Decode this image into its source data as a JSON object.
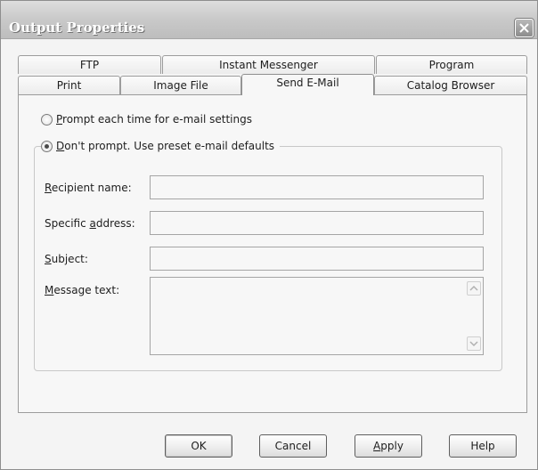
{
  "window": {
    "title": "Output Properties"
  },
  "tabs": {
    "row_back": [
      {
        "label": "FTP"
      },
      {
        "label": "Instant Messenger"
      },
      {
        "label": "Program"
      }
    ],
    "row_front": [
      {
        "label": "Print"
      },
      {
        "label": "Image File"
      },
      {
        "label": "Send E-Mail"
      },
      {
        "label": "Catalog Browser"
      }
    ],
    "active": "Send E-Mail"
  },
  "email": {
    "option_prompt": {
      "label": "Prompt each time for e-mail settings",
      "mnemonic": "P",
      "rest": "rompt each time for e-mail settings",
      "selected": false
    },
    "option_preset": {
      "label": "Don't prompt. Use preset e-mail defaults",
      "mnemonic": "D",
      "rest": "on't prompt. Use preset e-mail defaults",
      "selected": true
    },
    "recipient": {
      "label_pre": "",
      "mnemonic": "R",
      "label_post": "ecipient name:",
      "value": ""
    },
    "address": {
      "label_pre": "Specific ",
      "mnemonic": "a",
      "label_post": "ddress:",
      "value": ""
    },
    "subject": {
      "label_pre": "",
      "mnemonic": "S",
      "label_post": "ubject:",
      "value": ""
    },
    "message": {
      "label_pre": "",
      "mnemonic": "M",
      "label_post": "essage text:",
      "value": ""
    }
  },
  "buttons": {
    "ok": "OK",
    "cancel": "Cancel",
    "apply_mnemonic": "A",
    "apply_rest": "pply",
    "help": "Help"
  },
  "icons": {
    "close": "close-icon",
    "scroll_up": "scroll-up-icon",
    "scroll_down": "scroll-down-icon"
  }
}
